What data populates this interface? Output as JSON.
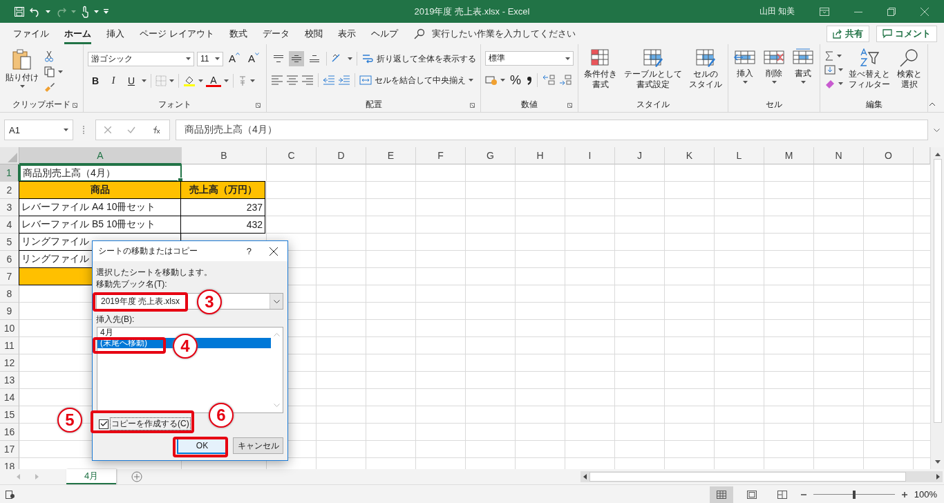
{
  "window": {
    "title": "2019年度 売上表.xlsx  -  Excel",
    "user": "山田 知美"
  },
  "menu_tabs": [
    {
      "label": "ファイル",
      "selected": false
    },
    {
      "label": "ホーム",
      "selected": true
    },
    {
      "label": "挿入",
      "selected": false
    },
    {
      "label": "ページ レイアウト",
      "selected": false
    },
    {
      "label": "数式",
      "selected": false
    },
    {
      "label": "データ",
      "selected": false
    },
    {
      "label": "校閲",
      "selected": false
    },
    {
      "label": "表示",
      "selected": false
    },
    {
      "label": "ヘルプ",
      "selected": false
    }
  ],
  "tell_me": {
    "placeholder": "実行したい作業を入力してください"
  },
  "share_button": "共有",
  "comment_button": "コメント",
  "ribbon": {
    "clipboard": {
      "paste": "貼り付け",
      "label": "クリップボード"
    },
    "font": {
      "name": "游ゴシック",
      "size": "11",
      "grow": "A",
      "shrink": "A",
      "bold": "B",
      "italic": "I",
      "underline": "U",
      "color_letter": "A",
      "label": "フォント"
    },
    "alignment": {
      "valign": [
        {
          "selected": false
        },
        {
          "selected": true
        },
        {
          "selected": false
        }
      ],
      "wrap": "折り返して全体を表示する",
      "merge": "セルを結合して中央揃え",
      "label": "配置"
    },
    "number": {
      "format": "標準",
      "percent": "%",
      "label": "数値"
    },
    "styles": {
      "buttons": [
        {
          "lines": [
            "条件付き",
            "書式"
          ],
          "kind": "conditional"
        },
        {
          "lines": [
            "テーブルとして",
            "書式設定"
          ],
          "kind": "table"
        },
        {
          "lines": [
            "セルの",
            "スタイル"
          ],
          "kind": "cellstyle"
        }
      ],
      "label": "スタイル"
    },
    "cells": {
      "buttons": [
        {
          "label": "挿入",
          "kind": "insert"
        },
        {
          "label": "削除",
          "kind": "delete"
        },
        {
          "label": "書式",
          "kind": "format"
        }
      ],
      "label": "セル"
    },
    "editing": {
      "buttons": [
        {
          "lines": [
            "並べ替えと",
            "フィルター"
          ],
          "kind": "sort"
        },
        {
          "lines": [
            "検索と",
            "選択"
          ],
          "kind": "find"
        }
      ],
      "label": "編集"
    }
  },
  "formula_bar": {
    "name_box": "A1",
    "formula": "商品別売上高（4月）"
  },
  "sheet": {
    "columns": [
      {
        "label": "A",
        "selected": true
      },
      {
        "label": "B",
        "selected": false
      },
      {
        "label": "C",
        "selected": false
      },
      {
        "label": "D",
        "selected": false
      },
      {
        "label": "E",
        "selected": false
      },
      {
        "label": "F",
        "selected": false
      },
      {
        "label": "G",
        "selected": false
      },
      {
        "label": "H",
        "selected": false
      },
      {
        "label": "I",
        "selected": false
      },
      {
        "label": "J",
        "selected": false
      },
      {
        "label": "K",
        "selected": false
      },
      {
        "label": "L",
        "selected": false
      },
      {
        "label": "M",
        "selected": false
      },
      {
        "label": "N",
        "selected": false
      },
      {
        "label": "O",
        "selected": false
      }
    ],
    "rows": [
      {
        "number": "1",
        "selected": true,
        "cells": [
          {
            "text": "商品別売上高（4月）",
            "kind": "title",
            "selected": true
          }
        ]
      },
      {
        "number": "2",
        "selected": false,
        "cells": [
          {
            "text": "商品",
            "kind": "header",
            "selected": false
          },
          {
            "text": "売上高（万円）",
            "kind": "header",
            "selected": false
          }
        ]
      },
      {
        "number": "3",
        "selected": false,
        "cells": [
          {
            "text": "レバーファイル A4 10冊セット",
            "kind": "item",
            "selected": false
          },
          {
            "text": "237",
            "kind": "number",
            "selected": false
          }
        ]
      },
      {
        "number": "4",
        "selected": false,
        "cells": [
          {
            "text": "レバーファイル B5 10冊セット",
            "kind": "item",
            "selected": false
          },
          {
            "text": "432",
            "kind": "number",
            "selected": false
          }
        ]
      },
      {
        "number": "5",
        "selected": false,
        "cells": [
          {
            "text": "リングファイル",
            "kind": "item",
            "selected": false
          }
        ]
      },
      {
        "number": "6",
        "selected": false,
        "cells": [
          {
            "text": "リングファイル",
            "kind": "item",
            "selected": false
          }
        ]
      },
      {
        "number": "7",
        "selected": false,
        "cells": [
          {
            "kind": "total",
            "selected": false
          }
        ]
      },
      {
        "number": "8",
        "selected": false
      },
      {
        "number": "9",
        "selected": false
      },
      {
        "number": "10",
        "selected": false
      },
      {
        "number": "11",
        "selected": false
      },
      {
        "number": "12",
        "selected": false
      },
      {
        "number": "13",
        "selected": false
      },
      {
        "number": "14",
        "selected": false
      },
      {
        "number": "15",
        "selected": false
      },
      {
        "number": "16",
        "selected": false
      },
      {
        "number": "17",
        "selected": false
      },
      {
        "number": "18",
        "selected": false
      }
    ]
  },
  "dialog": {
    "title": "シートの移動またはコピー",
    "help": "?",
    "message": "選択したシートを移動します。",
    "book_label": "移動先ブック名(T):",
    "book_value": "2019年度 売上表.xlsx",
    "insert_label": "挿入先(B):",
    "insert_items": [
      {
        "label": "4月",
        "selected": false
      },
      {
        "label": "(末尾へ移動)",
        "selected": true
      }
    ],
    "copy_checkbox": {
      "label": "コピーを作成する(C)",
      "checked": true
    },
    "ok": "OK",
    "cancel": "キャンセル"
  },
  "annotations": [
    {
      "label": "3"
    },
    {
      "label": "4"
    },
    {
      "label": "5"
    },
    {
      "label": "6"
    }
  ],
  "sheet_tabs": [
    {
      "label": "4月",
      "selected": true
    }
  ],
  "status_bar": {
    "views": [
      {
        "selected": true,
        "kind": "normal"
      },
      {
        "selected": false,
        "kind": "layout"
      },
      {
        "selected": false,
        "kind": "pagebreak"
      }
    ],
    "zoom_slider": {
      "level": 0.5
    },
    "zoom": "100%"
  }
}
